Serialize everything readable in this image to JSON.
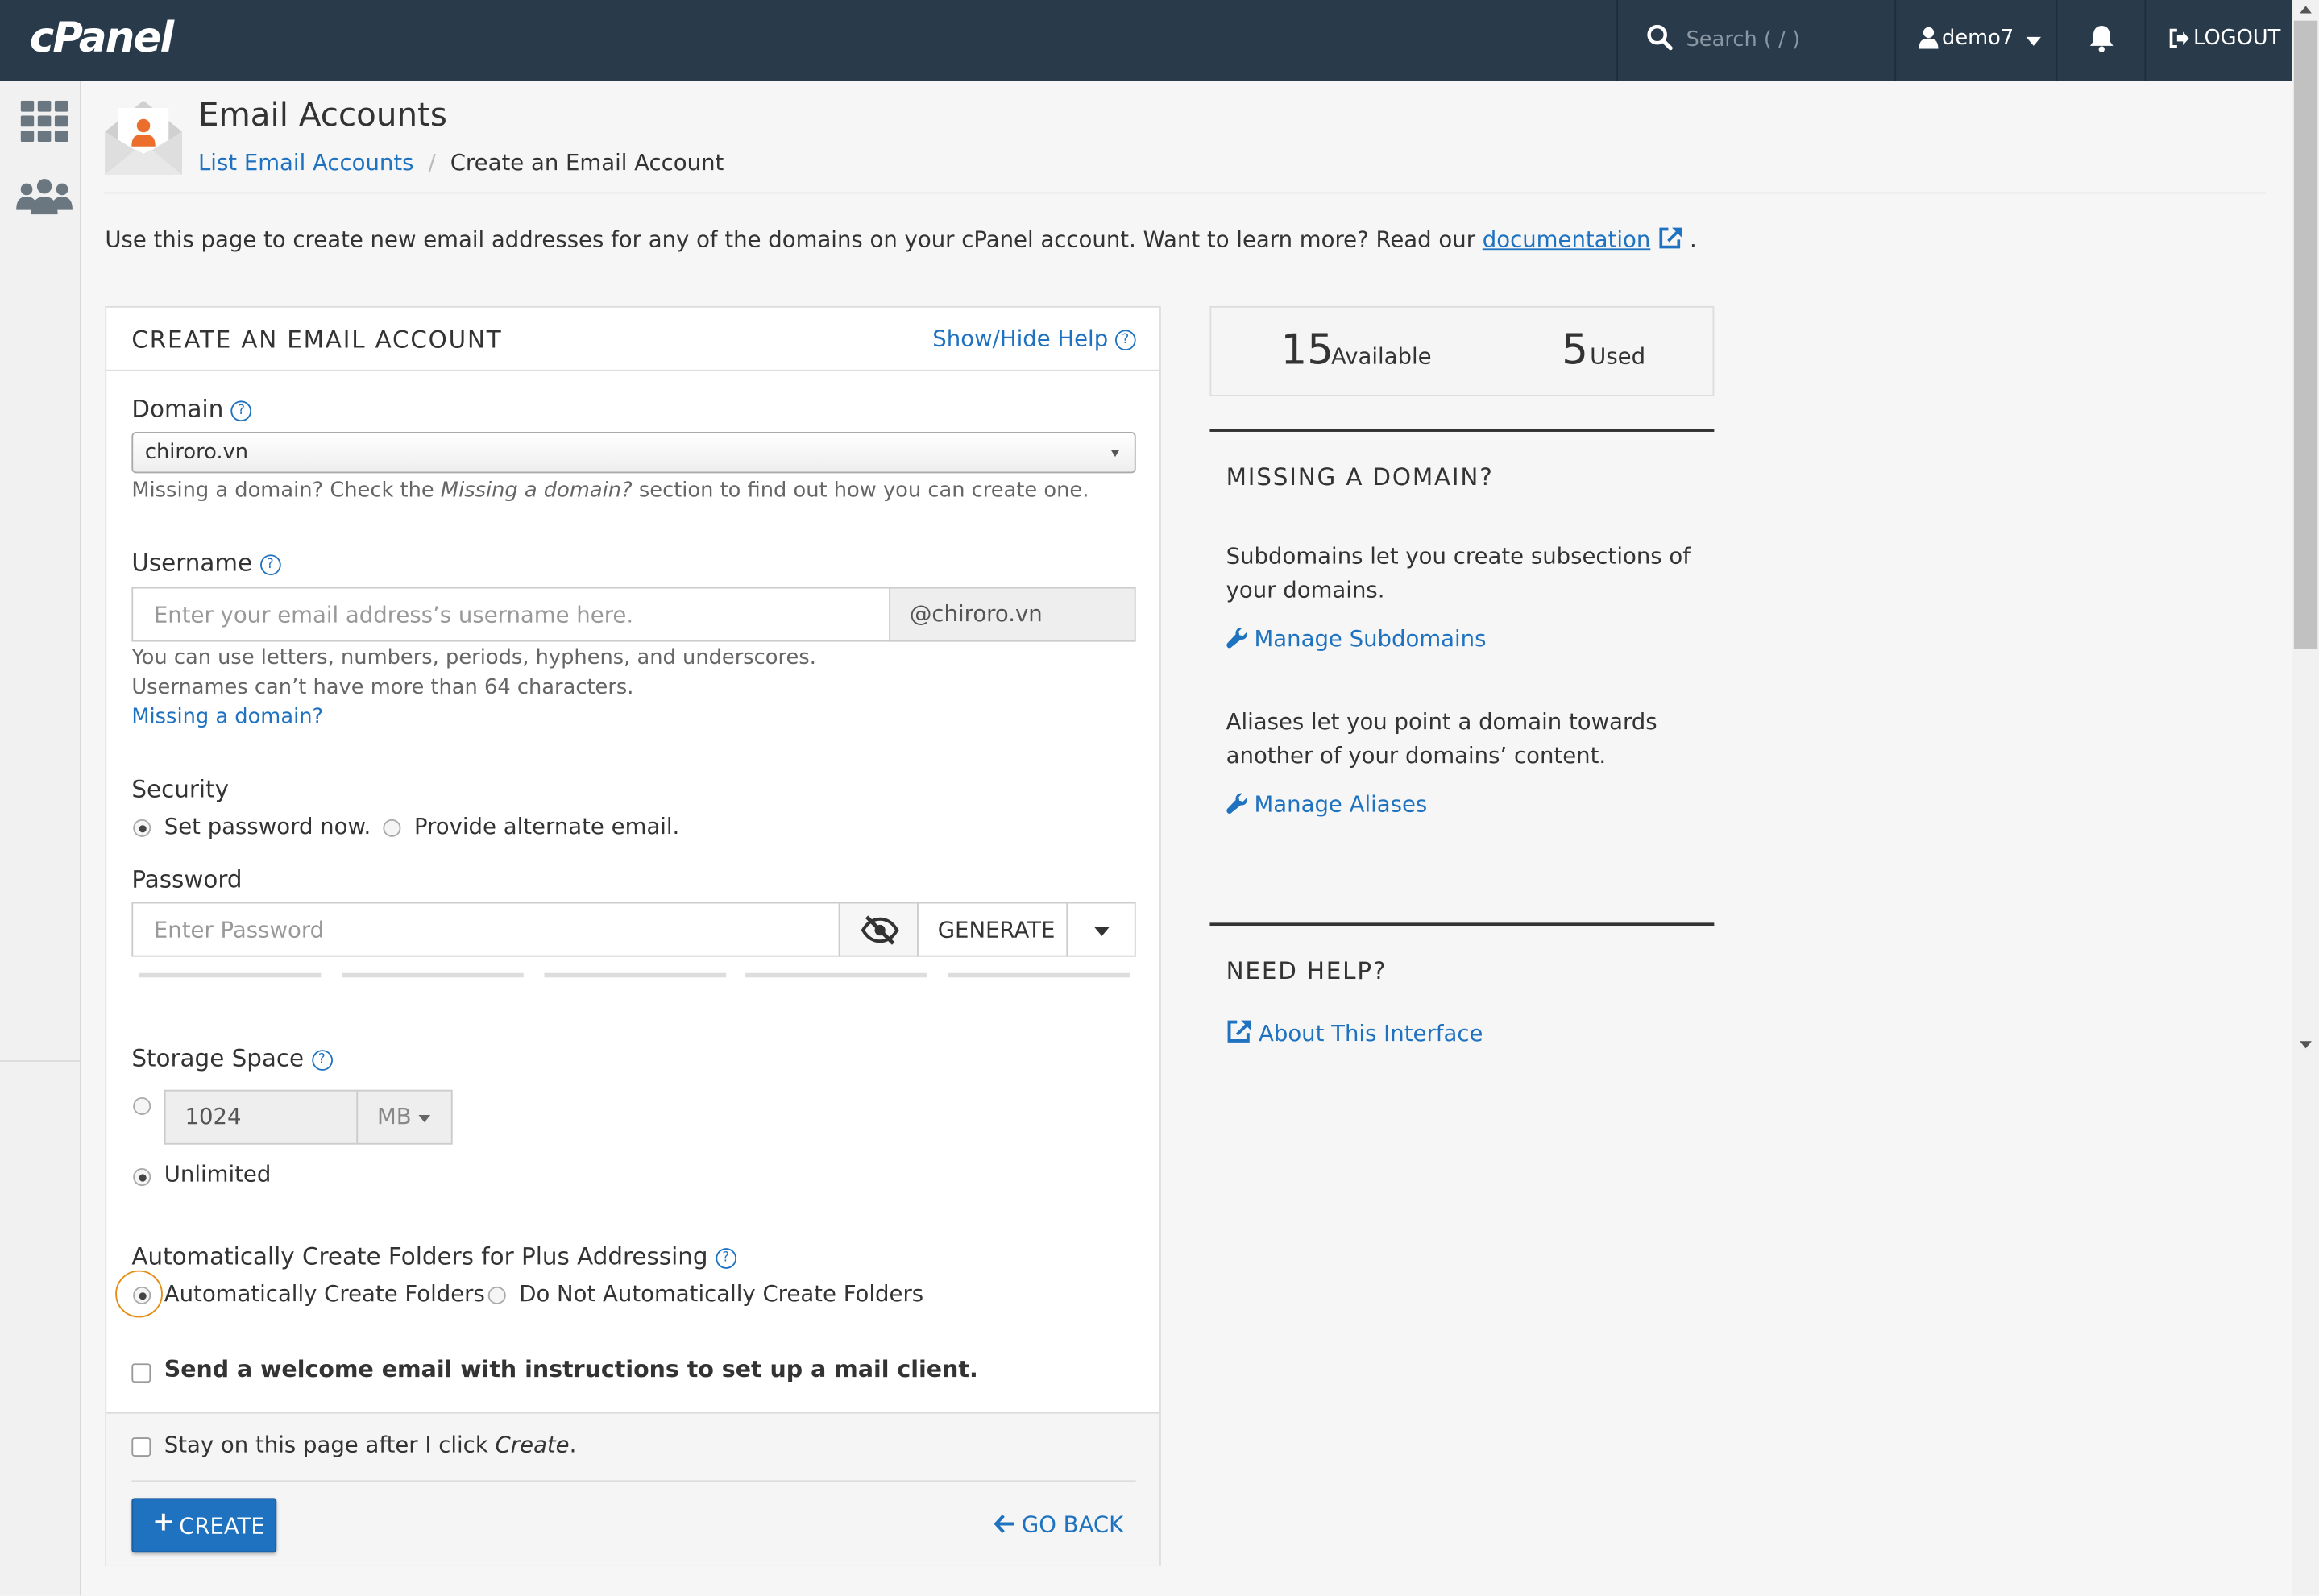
{
  "topbar": {
    "logo": "cPanel",
    "search_placeholder": "Search ( / )",
    "username": "demo7",
    "logout": "LOGOUT"
  },
  "header": {
    "title": "Email Accounts",
    "breadcrumb_link": "List Email Accounts",
    "breadcrumb_sep": "/",
    "breadcrumb_current": "Create an Email Account"
  },
  "intro": {
    "text": "Use this page to create new email addresses for any of the domains on your cPanel account. Want to learn more? Read our ",
    "link": "documentation",
    "end": "."
  },
  "form": {
    "title": "CREATE AN EMAIL ACCOUNT",
    "show_help": "Show/Hide Help",
    "domain_label": "Domain",
    "domain_value": "chiroro.vn",
    "domain_help_1": "Missing a domain? Check the ",
    "domain_help_em": "Missing a domain?",
    "domain_help_2": " section to find out how you can create one.",
    "username_label": "Username",
    "username_placeholder": "Enter your email address’s username here.",
    "username_suffix": "@chiroro.vn",
    "username_help_1": "You can use letters, numbers, periods, hyphens, and underscores.",
    "username_help_2": "Usernames can’t have more than 64 characters.",
    "missing_domain_link": "Missing a domain?",
    "security_label": "Security",
    "security_opt_1": "Set password now.",
    "security_opt_2": "Provide alternate email.",
    "password_label": "Password",
    "password_placeholder": "Enter Password",
    "generate": "GENERATE",
    "storage_label": "Storage Space",
    "storage_value": "1024",
    "storage_unit": "MB",
    "storage_unlimited": "Unlimited",
    "plus_label": "Automatically Create Folders for Plus Addressing",
    "plus_opt_1": "Automatically Create Folders",
    "plus_opt_2": "Do Not Automatically Create Folders",
    "welcome_email": "Send a welcome email with instructions to set up a mail client.",
    "stay_1": "Stay on this page after I click ",
    "stay_em": "Create",
    "stay_2": ".",
    "create": "CREATE",
    "go_back": "GO BACK"
  },
  "stats": {
    "available_num": "15",
    "available_label": "Available",
    "used_num": "5",
    "used_label": "Used"
  },
  "side": {
    "missing_title": "MISSING A DOMAIN?",
    "subdomains_text": "Subdomains let you create subsections of your domains.",
    "manage_subdomains": "Manage Subdomains",
    "aliases_text": "Aliases let you point a domain towards another of your domains’ content.",
    "manage_aliases": "Manage Aliases",
    "help_title": "NEED HELP?",
    "about": "About This Interface"
  },
  "colors": {
    "topbar": "#293a4a",
    "link": "#1e72c0",
    "primary_button": "#1e72c0",
    "focus_ring": "#e38d13"
  },
  "icons": [
    "search-icon",
    "user-icon",
    "bell-icon",
    "logout-icon",
    "grid-icon",
    "users-icon",
    "help-icon",
    "external-link-icon",
    "eye-slash-icon",
    "wrench-icon",
    "plus-icon",
    "arrow-left-icon"
  ]
}
